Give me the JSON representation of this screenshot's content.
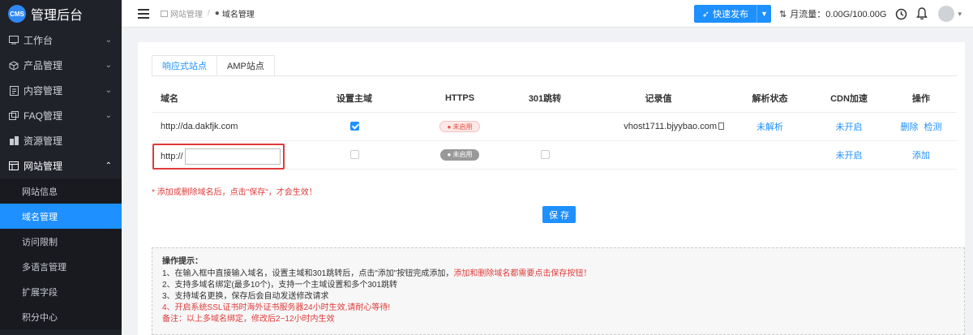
{
  "app": {
    "badge": "CMS",
    "title": "管理后台"
  },
  "sidebar": {
    "items": [
      {
        "label": "工作台"
      },
      {
        "label": "产品管理"
      },
      {
        "label": "内容管理"
      },
      {
        "label": "FAQ管理"
      },
      {
        "label": "资源管理"
      },
      {
        "label": "网站管理"
      }
    ],
    "subitems": [
      {
        "label": "网站信息"
      },
      {
        "label": "域名管理"
      },
      {
        "label": "访问限制"
      },
      {
        "label": "多语言管理"
      },
      {
        "label": "扩展字段"
      },
      {
        "label": "积分中心"
      }
    ]
  },
  "header": {
    "breadcrumb": [
      "网站管理",
      "域名管理"
    ],
    "publish_label": "快速发布",
    "traffic": "月流量：0.00G/100.00G"
  },
  "tabs": [
    "响应式站点",
    "AMP站点"
  ],
  "table": {
    "headers": [
      "域名",
      "设置主域",
      "HTTPS",
      "301跳转",
      "记录值",
      "解析状态",
      "CDN加速",
      "操作"
    ],
    "row1": {
      "domain": "http://da.dakfjk.com",
      "https": "● 未启用",
      "record": "vhost1711.bjyybao.com",
      "status": "未解析",
      "cdn": "未开启",
      "delete": "删除",
      "check": "检测"
    },
    "row2": {
      "prefix": "http://",
      "value": "",
      "placeholder": "",
      "https": "● 未启用",
      "cdn": "未开启",
      "add": "添加"
    }
  },
  "note": "* 添加或删除域名后，点击\"保存\"，才会生效！",
  "save_label": "保 存",
  "tips": {
    "title": "操作提示：",
    "line1a": "1、在输入框中直接输入域名，设置主域和301跳转后，点击\"添加\"按钮完成添加，",
    "line1b": "添加和删除域名都需要点击保存按钮！",
    "line2": "2、支持多域名绑定(最多10个)，支持一个主域设置和多个301跳转",
    "line3": "3、支持域名更换，保存后会自动发送修改请求",
    "line4": "4、开启系统SSL证书时海外证书服务器24小时生效,请耐心等待!",
    "line5": "备注：以上多域名绑定，修改后2~12小时内生效"
  },
  "colors": {
    "accent": "#1e90ff",
    "sidebar_bg": "#20222a",
    "warning": "#e03a3a"
  }
}
